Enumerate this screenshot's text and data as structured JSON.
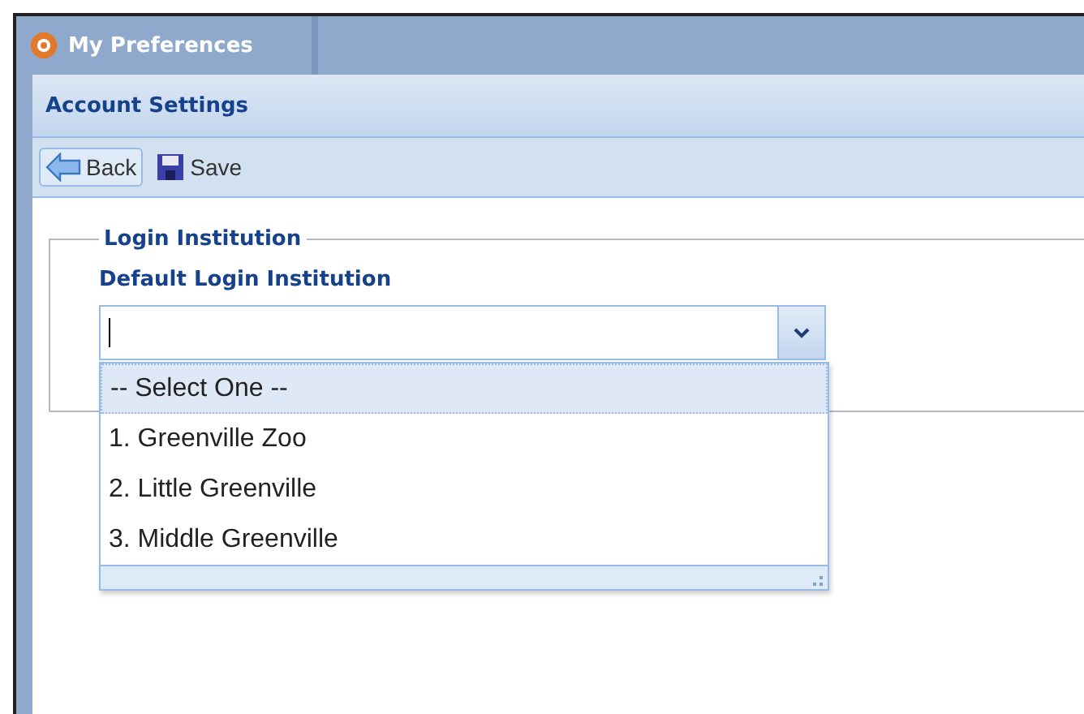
{
  "window": {
    "title": "My Preferences"
  },
  "panel": {
    "title": "Account Settings"
  },
  "toolbar": {
    "buttons": [
      {
        "label": "Back",
        "kind": "back"
      },
      {
        "label": "Save",
        "kind": "save"
      }
    ]
  },
  "fieldset": {
    "legend": "Login Institution",
    "field_label": "Default Login Institution"
  },
  "dropdown": {
    "options": [
      {
        "label": "-- Select One --",
        "selected": true
      },
      {
        "label": "1. Greenville Zoo",
        "selected": false
      },
      {
        "label": "2. Little Greenville",
        "selected": false
      },
      {
        "label": "3. Middle Greenville",
        "selected": false
      }
    ]
  }
}
